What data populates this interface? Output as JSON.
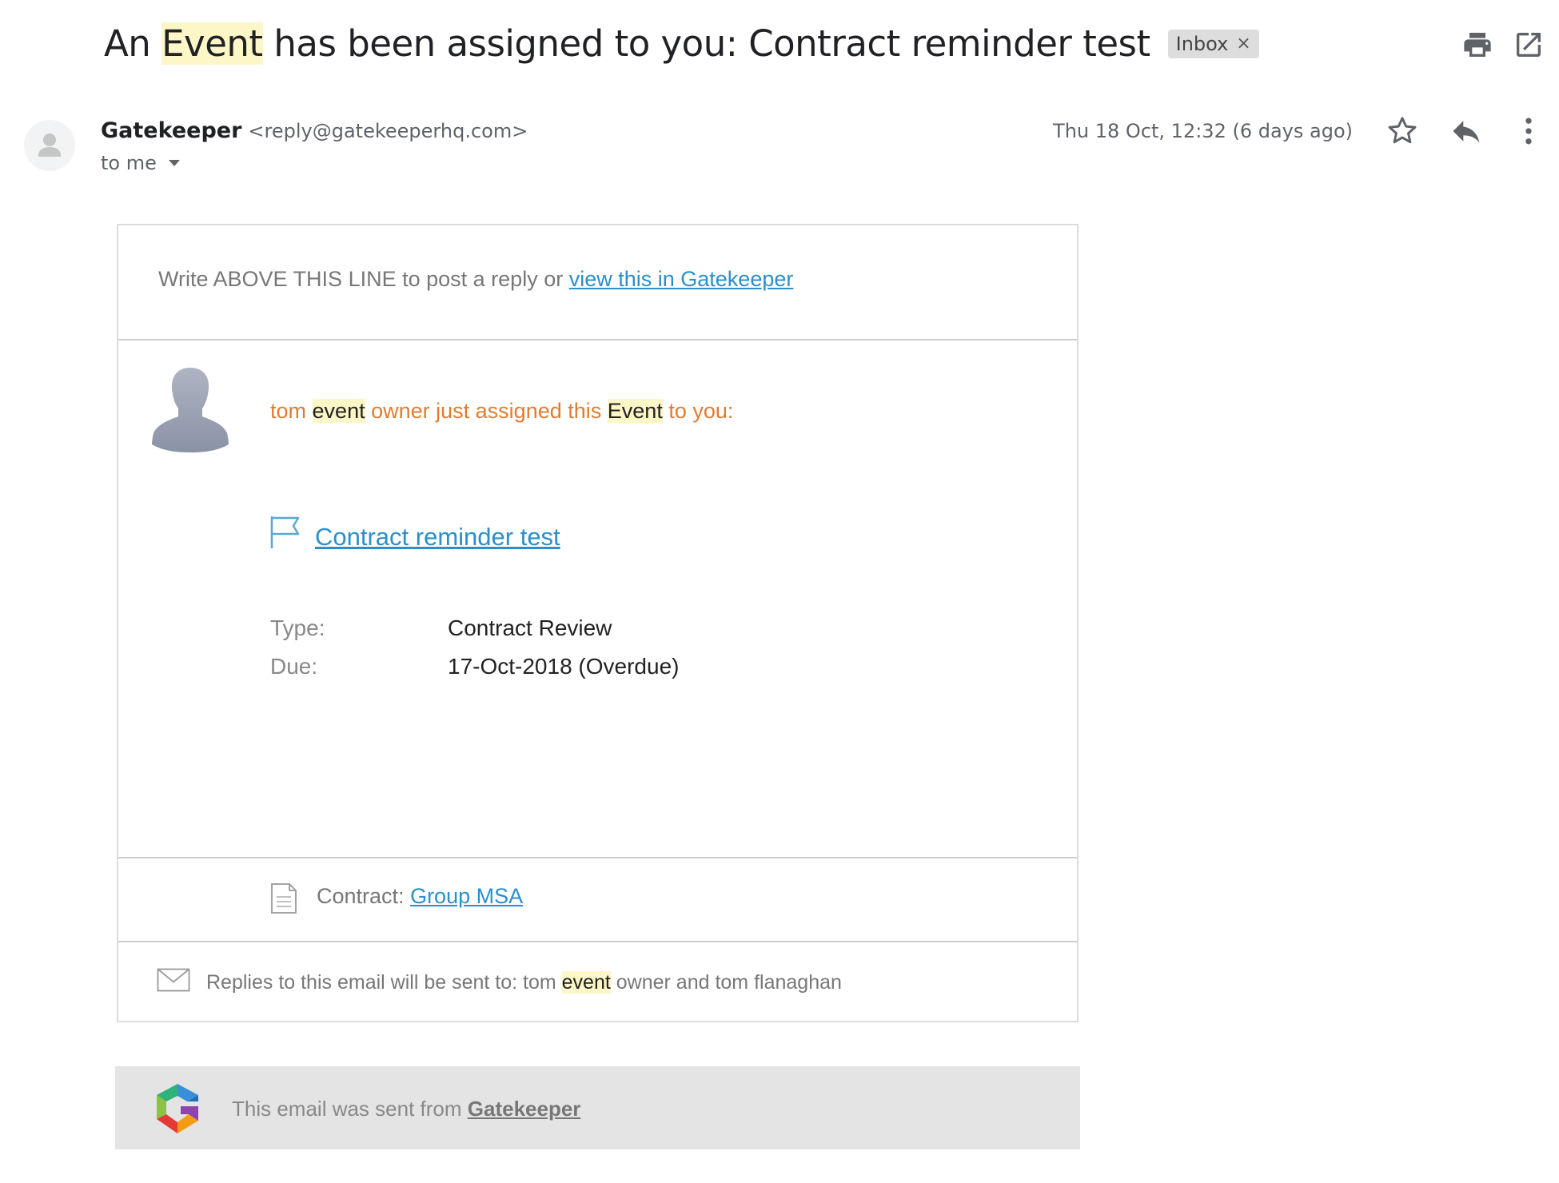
{
  "header": {
    "subject_prefix": "An",
    "subject_highlight": "Event",
    "subject_rest": "has been assigned to you: Contract reminder test",
    "label_chip": "Inbox",
    "label_chip_remove": "×",
    "print_icon": "print-icon",
    "open_new_window_icon": "open-in-new-window-icon"
  },
  "sender": {
    "name": "Gatekeeper",
    "email": "<reply@gatekeeperhq.com>",
    "recipient": "to me",
    "timestamp": "Thu 18 Oct, 12:32 (6 days ago)",
    "star_icon": "star-icon",
    "reply_icon": "reply-icon",
    "more_icon": "more-vert-icon"
  },
  "email": {
    "write_line_text": "Write ABOVE THIS LINE to post a reply or",
    "write_line_link": "view this in Gatekeeper",
    "assign": {
      "part1": "tom",
      "hl1": "event",
      "part2": "owner just assigned this",
      "hl2": "Event",
      "part3": "to you:"
    },
    "event_title": "Contract reminder test",
    "details": [
      {
        "label": "Type:",
        "value": "Contract Review"
      },
      {
        "label": "Due:",
        "value": "17-Oct-2018 (Overdue)"
      }
    ],
    "contract_label": "Contract:",
    "contract_link": "Group MSA",
    "replies": {
      "part1": "Replies to this email will be sent to: tom",
      "hl": "event",
      "part2": "owner and tom flanaghan"
    }
  },
  "footer": {
    "text": "This email was sent from",
    "link": "Gatekeeper"
  },
  "colors": {
    "highlight": "#fdf6c6",
    "link": "#2a8fcb",
    "assign_text": "#e27b2e"
  }
}
